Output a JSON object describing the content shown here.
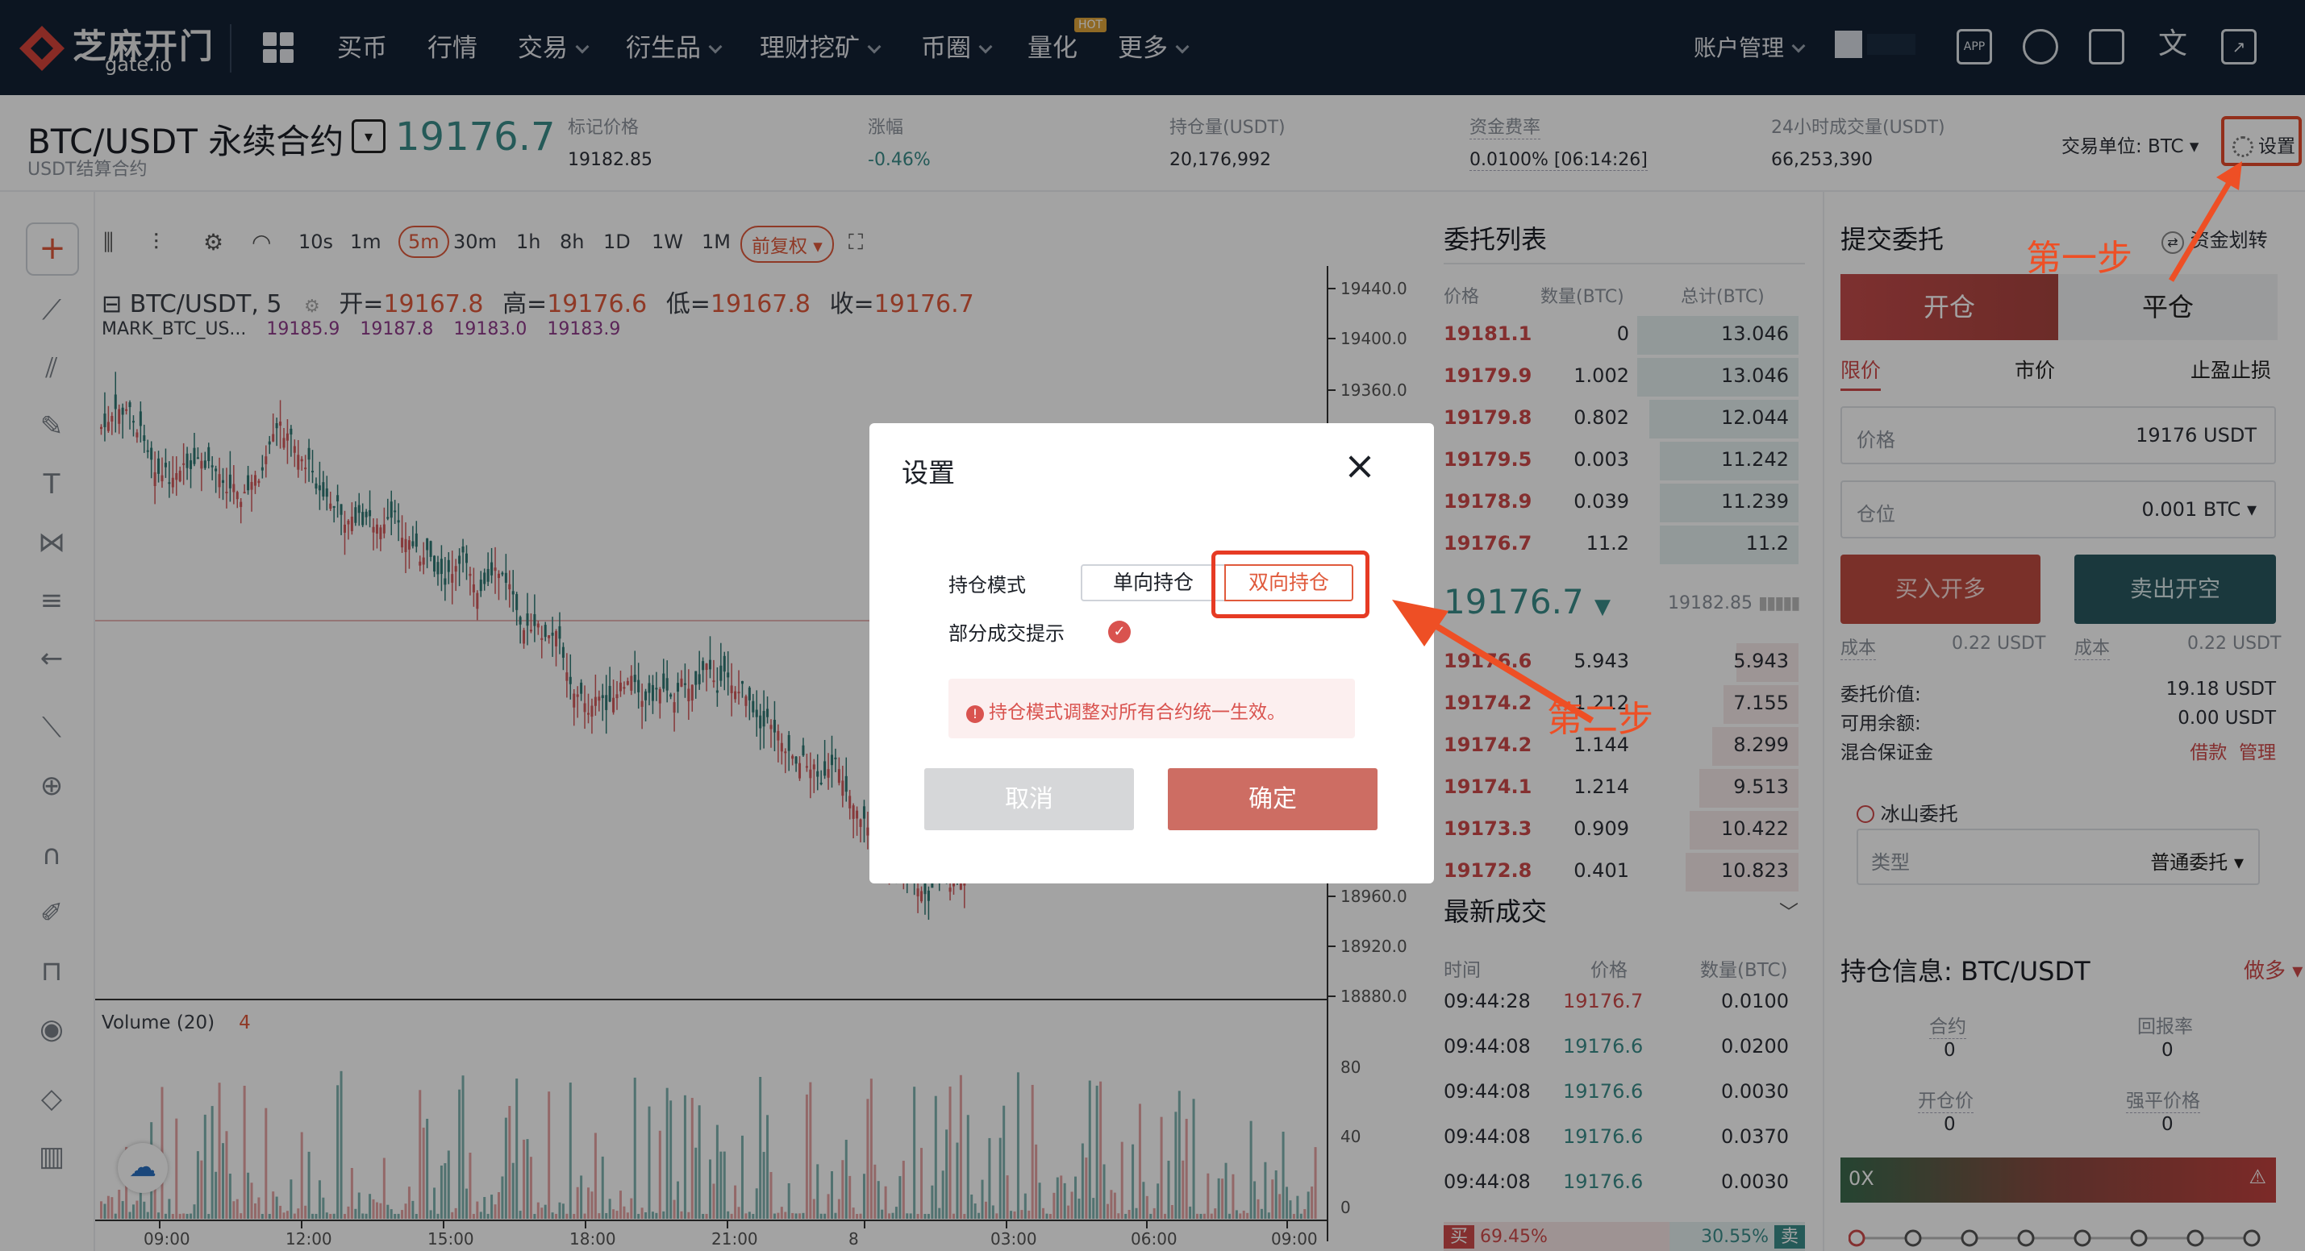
{
  "nav": {
    "logo_text": "芝麻开门",
    "logo_sub": "gate.io",
    "items": [
      {
        "label": "买币"
      },
      {
        "label": "行情"
      },
      {
        "label": "交易"
      },
      {
        "label": "衍生品"
      },
      {
        "label": "理财挖矿"
      },
      {
        "label": "币圈"
      },
      {
        "label": "量化"
      },
      {
        "label": "更多"
      }
    ],
    "hot_badge": "HOT",
    "account": "账户管理",
    "icons": [
      "app-icon",
      "support-icon",
      "screen-settings-icon",
      "language-icon",
      "popout-icon"
    ],
    "app_icon_text": "APP"
  },
  "ticker": {
    "pair": "BTC/USDT 永续合约",
    "price": "19176.7",
    "settle": "USDT结算合约",
    "stats": [
      {
        "label": "标记价格",
        "value": "19182.85"
      },
      {
        "label": "涨幅",
        "value": "-0.46%"
      },
      {
        "label": "持仓量(USDT)",
        "value": "20,176,992"
      },
      {
        "label": "资金费率",
        "value": "0.0100% [06:14:26]"
      },
      {
        "label": "24小时成交量(USDT)",
        "value": "66,253,390"
      }
    ],
    "unit": "交易单位: BTC",
    "settings": "设置"
  },
  "chart": {
    "intervals": [
      "10s",
      "1m",
      "5m",
      "30m",
      "1h",
      "8h",
      "1D",
      "1W",
      "1M"
    ],
    "active_interval": "5m",
    "restore": "前复权",
    "symbol": "BTC/USDT, 5",
    "open_label": "开=",
    "open": "19167.8",
    "high_label": "高=",
    "high": "19176.6",
    "low_label": "低=",
    "low": "19167.8",
    "close_label": "收=",
    "close": "19176.7",
    "mark_label": "MARK_BTC_US...",
    "mark_vals": [
      "19185.9",
      "19187.8",
      "19183.0",
      "19183.9"
    ],
    "price_ticks": [
      "19440.0",
      "19400.0",
      "19360.0",
      "18960.0",
      "18920.0",
      "18880.0"
    ],
    "time_ticks": [
      "09:00",
      "12:00",
      "15:00",
      "18:00",
      "21:00",
      "8",
      "03:00",
      "06:00",
      "09:00"
    ],
    "volume_label": "Volume (20)",
    "volume_val": "4",
    "volume_ticks": [
      "80",
      "40",
      "0"
    ]
  },
  "orderbook": {
    "title": "委托列表",
    "headers": [
      "价格",
      "数量(BTC)",
      "总计(BTC)"
    ],
    "asks": [
      {
        "price": "19181.1",
        "qty": "0",
        "total": "13.046"
      },
      {
        "price": "19179.9",
        "qty": "1.002",
        "total": "13.046"
      },
      {
        "price": "19179.8",
        "qty": "0.802",
        "total": "12.044"
      },
      {
        "price": "19179.5",
        "qty": "0.003",
        "total": "11.242"
      },
      {
        "price": "19178.9",
        "qty": "0.039",
        "total": "11.239"
      },
      {
        "price": "19176.7",
        "qty": "11.2",
        "total": "11.2"
      }
    ],
    "mid": "19176.7",
    "mid_mark": "19182.85",
    "bids": [
      {
        "price": "19176.6",
        "qty": "5.943",
        "total": "5.943"
      },
      {
        "price": "19174.2",
        "qty": "1.212",
        "total": "7.155"
      },
      {
        "price": "19174.2",
        "qty": "1.144",
        "total": "8.299"
      },
      {
        "price": "19174.1",
        "qty": "1.214",
        "total": "9.513"
      },
      {
        "price": "19173.3",
        "qty": "0.909",
        "total": "10.422"
      },
      {
        "price": "19172.8",
        "qty": "0.401",
        "total": "10.823"
      }
    ]
  },
  "trades": {
    "title": "最新成交",
    "headers": [
      "时间",
      "价格",
      "数量(BTC)"
    ],
    "rows": [
      {
        "time": "09:44:28",
        "price": "19176.7",
        "qty": "0.0100"
      },
      {
        "time": "09:44:08",
        "price": "19176.6",
        "qty": "0.0200"
      },
      {
        "time": "09:44:08",
        "price": "19176.6",
        "qty": "0.0030"
      },
      {
        "time": "09:44:08",
        "price": "19176.6",
        "qty": "0.0370"
      },
      {
        "time": "09:44:08",
        "price": "19176.6",
        "qty": "0.0030"
      }
    ],
    "buy_label": "买",
    "buy_pct": "69.45%",
    "sell_label": "卖",
    "sell_pct": "30.55%"
  },
  "order": {
    "title": "提交委托",
    "transfer": "资金划转",
    "open": "开仓",
    "close": "平仓",
    "types": [
      "限价",
      "市价",
      "止盈止损"
    ],
    "price_label": "价格",
    "price_value": "19176 USDT",
    "size_label": "仓位",
    "size_value": "0.001 BTC",
    "buy": "买入开多",
    "sell": "卖出开空",
    "cost_label": "成本",
    "buy_cost": "0.22 USDT",
    "sell_cost": "0.22 USDT",
    "order_value_label": "委托价值:",
    "order_value": "19.18 USDT",
    "avail_label": "可用余额:",
    "avail": "0.00 USDT",
    "margin_label": "混合保证金",
    "borrow": "借款",
    "manage": "管理",
    "iceberg": "冰山委托",
    "type_label": "类型",
    "type_value": "普通委托"
  },
  "position": {
    "title": "持仓信息: BTC/USDT",
    "more": "做多",
    "contract_label": "合约",
    "contract": "0",
    "roe_label": "回报率",
    "roe": "0",
    "open_price_label": "开仓价",
    "open_price": "0",
    "liq_label": "强平价格",
    "liq": "0",
    "leverage": "0X"
  },
  "modal": {
    "title": "设置",
    "mode_label": "持仓模式",
    "one_way": "单向持仓",
    "two_way": "双向持仓",
    "partial_label": "部分成交提示",
    "warning": "持仓模式调整对所有合约统一生效。",
    "cancel": "取消",
    "confirm": "确定"
  },
  "annotations": {
    "step1": "第一步",
    "step2": "第二步"
  }
}
